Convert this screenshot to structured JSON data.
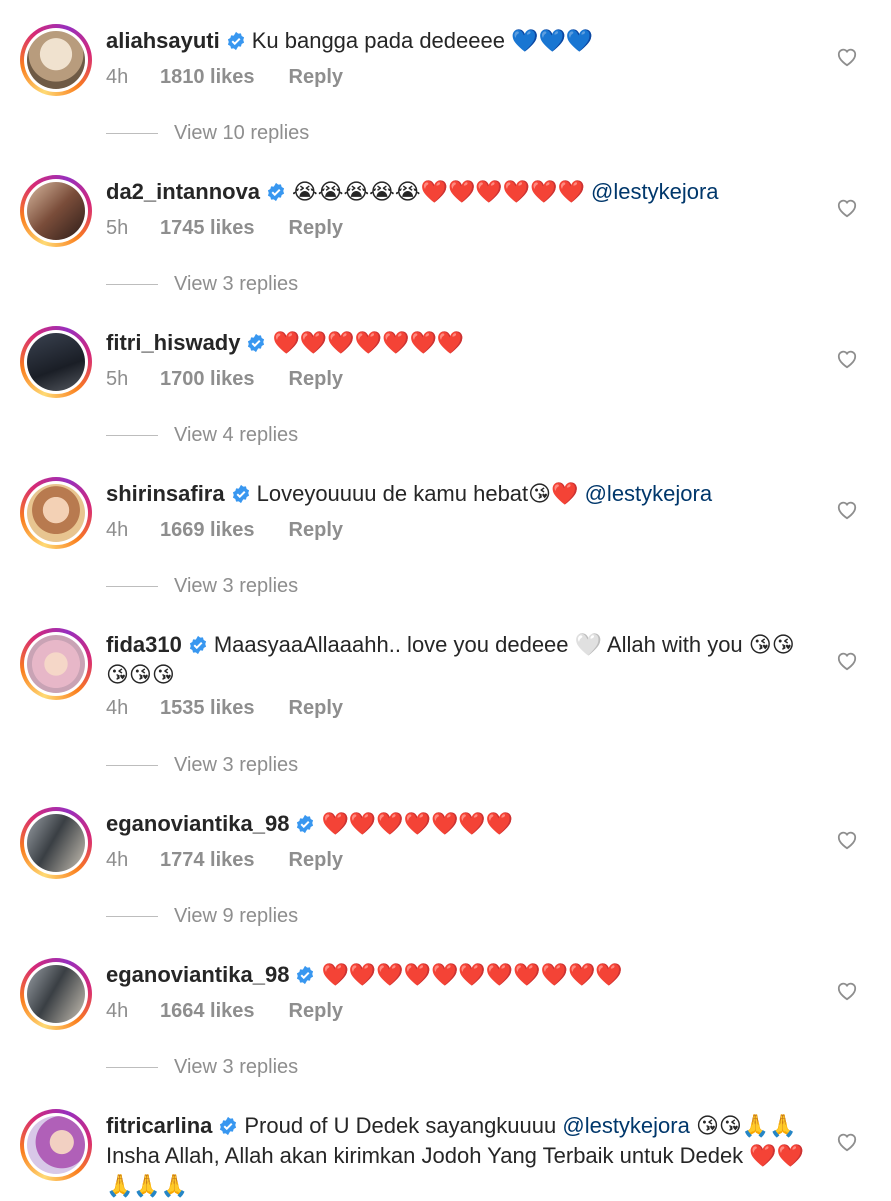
{
  "comments": [
    {
      "username": "aliahsayuti",
      "text": "Ku bangga pada dedeeee 💙💙💙",
      "mention": "",
      "text2": "",
      "time": "4h",
      "likes": "1810 likes",
      "reply": "Reply",
      "view_replies": "View 10 replies"
    },
    {
      "username": "da2_intannova",
      "text": "😭😭😭😭😭❤️❤️❤️❤️❤️❤️ ",
      "mention": "@lestykejora",
      "text2": "",
      "time": "5h",
      "likes": "1745 likes",
      "reply": "Reply",
      "view_replies": "View 3 replies"
    },
    {
      "username": "fitri_hiswady",
      "text": "❤️❤️❤️❤️❤️❤️❤️",
      "mention": "",
      "text2": "",
      "time": "5h",
      "likes": "1700 likes",
      "reply": "Reply",
      "view_replies": "View 4 replies"
    },
    {
      "username": "shirinsafira",
      "text": "Loveyouuuu de kamu hebat😘❤️ ",
      "mention": "@lestykejora",
      "text2": "",
      "time": "4h",
      "likes": "1669 likes",
      "reply": "Reply",
      "view_replies": "View 3 replies"
    },
    {
      "username": "fida310",
      "text": "MaasyaaAllaaahh.. love you dedeee 🤍 Allah with you 😘😘😘😘😘",
      "mention": "",
      "text2": "",
      "time": "4h",
      "likes": "1535 likes",
      "reply": "Reply",
      "view_replies": "View 3 replies"
    },
    {
      "username": "eganoviantika_98",
      "text": "❤️❤️❤️❤️❤️❤️❤️",
      "mention": "",
      "text2": "",
      "time": "4h",
      "likes": "1774 likes",
      "reply": "Reply",
      "view_replies": "View 9 replies"
    },
    {
      "username": "eganoviantika_98",
      "text": "❤️❤️❤️❤️❤️❤️❤️❤️❤️❤️❤️",
      "mention": "",
      "text2": "",
      "time": "4h",
      "likes": "1664 likes",
      "reply": "Reply",
      "view_replies": "View 3 replies"
    },
    {
      "username": "fitricarlina",
      "text": "Proud of U Dedek sayangkuuuu ",
      "mention": "@lestykejora",
      "text2": " 😘😘🙏🙏 Insha Allah, Allah akan kirimkan Jodoh Yang Terbaik untuk Dedek ❤️❤️🙏🙏🙏",
      "time": "",
      "likes": "",
      "reply": "",
      "view_replies": ""
    }
  ],
  "icons": {
    "verified": "verified-badge-icon",
    "like": "heart-outline-icon"
  },
  "colors": {
    "verified_blue": "#3897f0",
    "mention": "#00376b",
    "meta_gray": "#8e8e8e"
  }
}
